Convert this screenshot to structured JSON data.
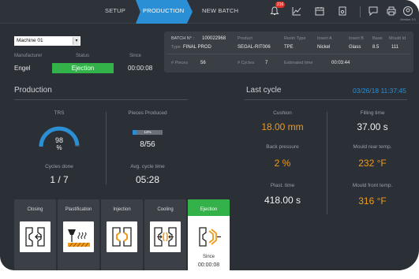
{
  "nav": {
    "tabs": [
      "SETUP",
      "PRODUCTION",
      "NEW BATCH"
    ],
    "active_tab": "PRODUCTION",
    "alarm_badge": "216",
    "version": "Version 3.1",
    "icons": [
      "bell-icon",
      "chart-icon",
      "calendar-icon",
      "document-icon",
      "comment-icon",
      "printer-icon",
      "user-icon"
    ]
  },
  "machine": {
    "selected": "Machine 01",
    "manufacturer_label": "Manufacturer",
    "manufacturer": "Engel",
    "status_label": "Status",
    "status": "Ejection",
    "since_label": "Since",
    "since": "00:00:08"
  },
  "batch": {
    "batch_label": "BATCH N° :",
    "batch_no": "100022968",
    "type_label": "Type",
    "type": "FINAL PROD",
    "product_label": "Product",
    "product": "SEGAL-RIT006",
    "resin_label": "Resin Type",
    "resin": "TPE",
    "insert_a_label": "Insert A",
    "insert_a": "Nickel",
    "insert_b_label": "Insert B",
    "insert_b": "Glass",
    "base_label": "Base",
    "base": "8.5",
    "mould_label": "Mould Id",
    "mould": "111",
    "pieces_label": "# Pieces",
    "pieces": "56",
    "cycles_label": "# Cycles",
    "cycles": "7",
    "est_label": "Estimated time",
    "est": "00:03:44"
  },
  "production": {
    "title": "Production",
    "trs_label": "TRS",
    "trs_value": "98",
    "trs_unit": "%",
    "trs_fraction": 0.98,
    "pieces_label": "Pieces Produced",
    "pieces_percent": "14%",
    "pieces_fraction": 0.14,
    "pieces_value": "8/56",
    "cycles_done_label": "Cycles done",
    "cycles_done": "1 / 7",
    "avg_label": "Avg. cycle time",
    "avg_value": "05:28"
  },
  "phases": [
    {
      "label": "Closing",
      "icon": "closing-mould-icon"
    },
    {
      "label": "Plastification",
      "icon": "plastification-icon"
    },
    {
      "label": "Injection",
      "icon": "injection-icon"
    },
    {
      "label": "Cooling",
      "icon": "cooling-icon"
    },
    {
      "label": "Ejection",
      "icon": "ejection-icon",
      "since_label": "Since",
      "since": "00:00:08"
    }
  ],
  "last_cycle": {
    "title": "Last cycle",
    "timestamp": "03/26/18 11:37:45",
    "cushion_label": "Cushion",
    "cushion": "18.00 mm",
    "back_pressure_label": "Back pressure",
    "back_pressure": "2 %",
    "plast_label": "Plast. time",
    "plast": "418.00 s",
    "filling_label": "Filling time",
    "filling": "37.00 s",
    "rear_label": "Mould rear temp.",
    "rear": "232 °F",
    "front_label": "Mould front temp.",
    "front": "316 °F"
  },
  "colors": {
    "accent_blue": "#2b8fd6",
    "status_green": "#34b24a",
    "value_orange": "#f29a1a",
    "background": "#2b2f36"
  }
}
